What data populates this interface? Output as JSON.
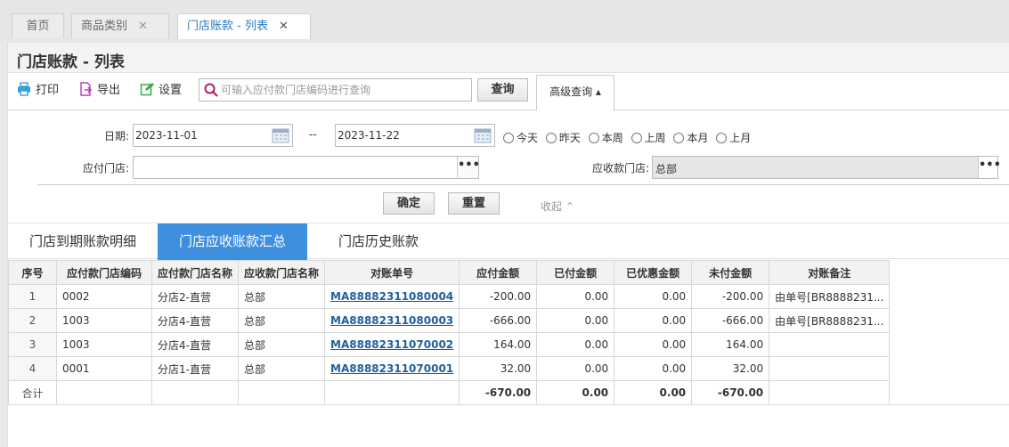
{
  "top_tabs": [
    {
      "label": "首页"
    },
    {
      "label": "商品类别",
      "close": "✕"
    },
    {
      "label": "门店账款 - 列表",
      "close": "✕"
    }
  ],
  "page_title": "门店账款 - 列表",
  "toolbar": {
    "print_label": "打印",
    "export_label": "导出",
    "settings_label": "设置",
    "search_placeholder": "可输入应付款门店编码进行查询",
    "query_label": "查询",
    "advanced_label": "高级查询 ▴"
  },
  "filters": {
    "date_label": "日期:",
    "date_from": "2023-11-01",
    "date_sep": "--",
    "date_to": "2023-11-22",
    "quick_ranges": [
      "今天",
      "昨天",
      "本周",
      "上周",
      "本月",
      "上月"
    ],
    "pay_store_label": "应付门店:",
    "pay_store_value": "",
    "recv_store_label": "应收款门店:",
    "recv_store_value": "总部",
    "more_glyph": "•••",
    "confirm_label": "确定",
    "reset_label": "重置",
    "collapse_label": "收起 ⌃"
  },
  "result_tabs": [
    "门店到期账款明细",
    "门店应收账款汇总",
    "门店历史账款"
  ],
  "table": {
    "headers": [
      "序号",
      "应付款门店编码",
      "应付款门店名称",
      "应收款门店名称",
      "对账单号",
      "应付金额",
      "已付金额",
      "已优惠金额",
      "未付金额",
      "对账备注"
    ],
    "rows": [
      [
        "1",
        "0002",
        "分店2-直营",
        "总部",
        "MA88882311080004",
        "-200.00",
        "0.00",
        "0.00",
        "-200.00",
        "由单号[BR8888231..."
      ],
      [
        "2",
        "1003",
        "分店4-直营",
        "总部",
        "MA88882311080003",
        "-666.00",
        "0.00",
        "0.00",
        "-666.00",
        "由单号[BR8888231..."
      ],
      [
        "3",
        "1003",
        "分店4-直营",
        "总部",
        "MA88882311070002",
        "164.00",
        "0.00",
        "0.00",
        "164.00",
        ""
      ],
      [
        "4",
        "0001",
        "分店1-直营",
        "总部",
        "MA88882311070001",
        "32.00",
        "0.00",
        "0.00",
        "32.00",
        ""
      ]
    ],
    "total": [
      "合计",
      "",
      "",
      "",
      "",
      "-670.00",
      "0.00",
      "0.00",
      "-670.00",
      ""
    ]
  },
  "colors": {
    "accent": "#3f8fdf",
    "link": "#1f5f9f",
    "active_tab_text": "#2b7bbd"
  }
}
